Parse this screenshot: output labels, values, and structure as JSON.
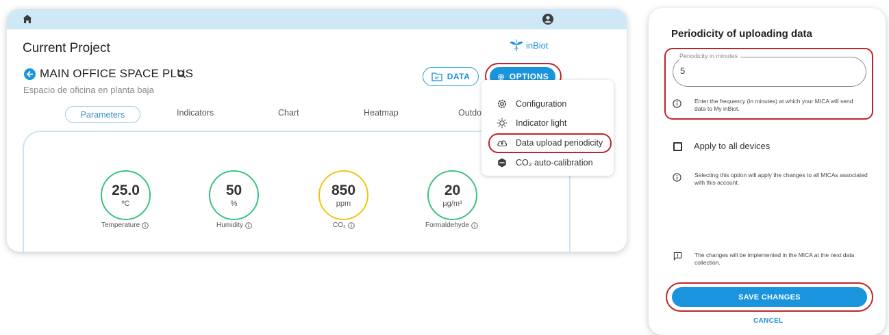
{
  "app": {
    "current_project_label": "Current Project",
    "brand": "inBiot",
    "project_name": "MAIN OFFICE SPACE PLUS",
    "project_description": "Espacio de oficina en planta baja",
    "data_button": "DATA",
    "options_button": "OPTIONS",
    "tabs": [
      {
        "label": "Parameters",
        "active": true
      },
      {
        "label": "Indicators"
      },
      {
        "label": "Chart"
      },
      {
        "label": "Heatmap"
      },
      {
        "label": "Outdoor"
      }
    ],
    "gauges": [
      {
        "value": "25.0",
        "unit": "ºC",
        "label": "Temperature",
        "color": "#36c37c"
      },
      {
        "value": "50",
        "unit": "%",
        "label": "Humidity",
        "color": "#36c37c"
      },
      {
        "value": "850",
        "unit": "ppm",
        "label": "CO₂",
        "color": "#f1c40f"
      },
      {
        "value": "20",
        "unit": "µg/m³",
        "label": "Formaldehyde",
        "color": "#36c37c"
      }
    ]
  },
  "options_menu": {
    "items": [
      {
        "label": "Configuration",
        "icon": "gear-icon"
      },
      {
        "label": "Indicator light",
        "icon": "sun-icon"
      },
      {
        "label": "Data upload periodicity",
        "icon": "cloud-upload-icon"
      },
      {
        "label": "CO₂ auto-calibration",
        "icon": "co2-badge-icon"
      }
    ]
  },
  "panel": {
    "title": "Periodicity of uploading data",
    "field_label": "Periodicity in minutes",
    "field_value": "5",
    "field_help": "Enter the frequency (in minutes) at which your MICA will send data to My inBiot.",
    "apply_label": "Apply to all devices",
    "apply_help": "Selecting this option will apply the changes to all MICAs associated with this account.",
    "changes_note": "The changes will be implemented in the MICA at the next data collection.",
    "save_button": "SAVE CHANGES",
    "cancel_link": "CANCEL"
  },
  "colors": {
    "accent": "#1a95dd",
    "highlight": "#c0222b",
    "topbar": "#cfe8f7"
  }
}
